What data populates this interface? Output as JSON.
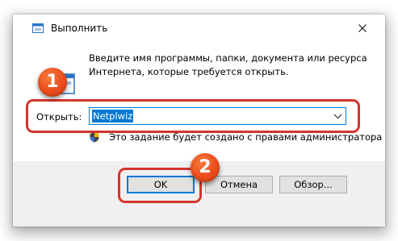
{
  "window": {
    "title": "Выполнить"
  },
  "dialog": {
    "description_line1": "Введите имя программы, папки, документа или ресурса",
    "description_line2": "Интернета, которые требуется открыть.",
    "open_label": "Открыть:",
    "open_value": "Netplwiz",
    "admin_note": "Это задание будет создано с правами администратора"
  },
  "buttons": {
    "ok": "OK",
    "cancel": "Отмена",
    "browse": "Обзор..."
  },
  "annotations": {
    "step1": "1",
    "step2": "2"
  },
  "colors": {
    "accent": "#0078d7",
    "annotation": "#d4342e",
    "badge": "#ea4d1b"
  },
  "icons": {
    "title": "run-icon",
    "close": "close-icon",
    "program": "run-program-icon",
    "dropdown": "chevron-down-icon",
    "uac": "uac-shield-icon"
  }
}
